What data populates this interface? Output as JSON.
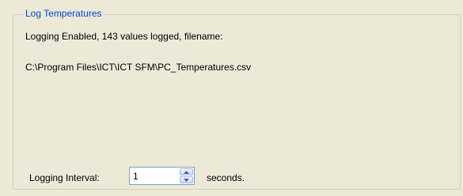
{
  "group": {
    "title": "Log Temperatures"
  },
  "status": {
    "line": "Logging Enabled, 143 values logged, filename:"
  },
  "file": {
    "path": "C:\\Program Files\\ICT\\ICT SFM\\PC_Temperatures.csv"
  },
  "interval": {
    "label": "Logging Interval:",
    "value": "1",
    "unit": "seconds."
  },
  "icons": {
    "up": "spin-up-icon",
    "down": "spin-down-icon"
  }
}
